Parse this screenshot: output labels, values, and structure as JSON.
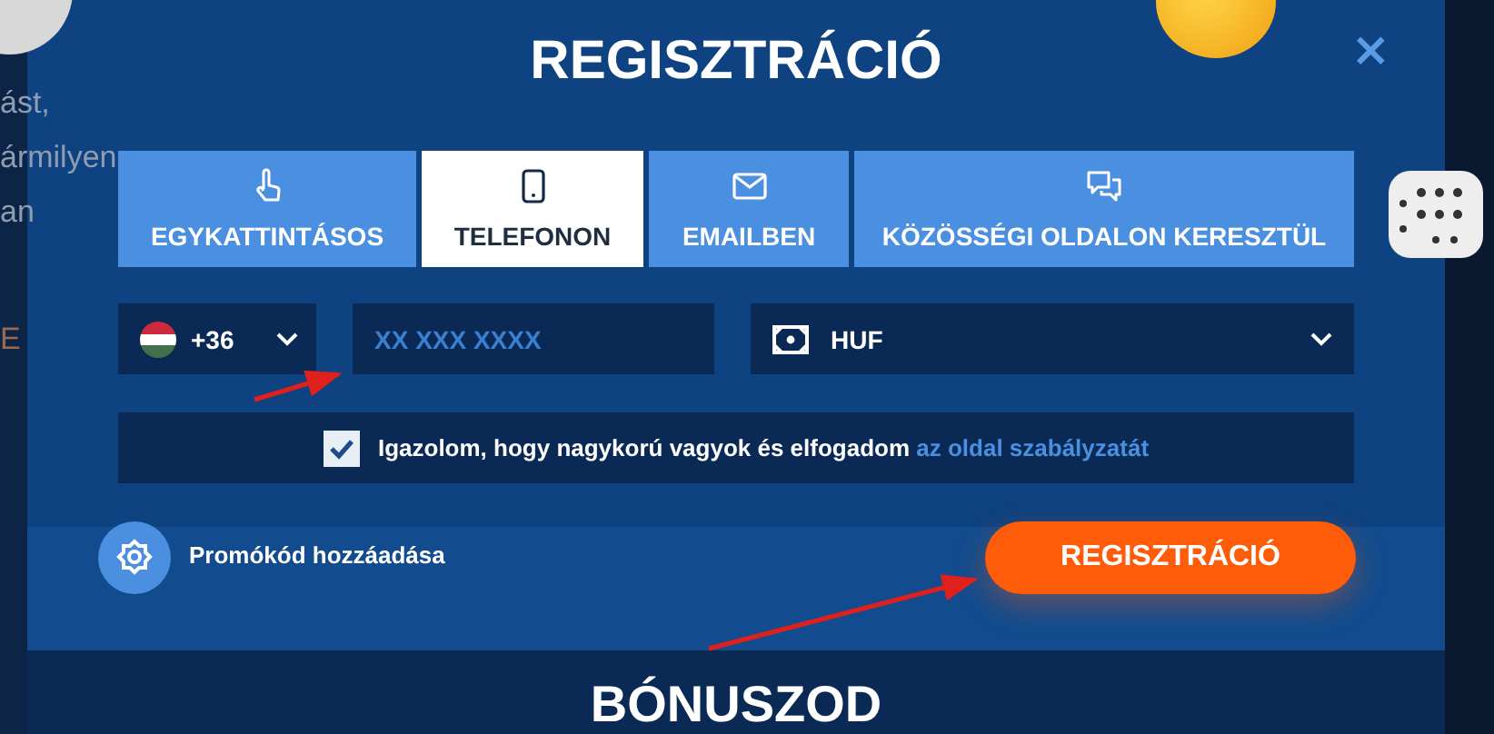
{
  "background_text": [
    "ást,",
    "ármilyen",
    "an",
    "E"
  ],
  "dialog": {
    "title": "REGISZTRÁCIÓ",
    "close": "×"
  },
  "tabs": [
    {
      "label": "EGYKATTINTÁSOS",
      "kind": "oneclick",
      "selected": false
    },
    {
      "label": "TELEFONON",
      "kind": "phone",
      "selected": true
    },
    {
      "label": "EMAILBEN",
      "kind": "email",
      "selected": false
    },
    {
      "label": "KÖZÖSSÉGI OLDALON KERESZTÜL",
      "kind": "social",
      "selected": false
    }
  ],
  "phone": {
    "country_code": "+36",
    "placeholder": "XX XXX XXXX"
  },
  "currency": {
    "value": "HUF"
  },
  "terms": {
    "checked": true,
    "text": "Igazolom, hogy nagykorú vagyok és elfogadom",
    "link": "az oldal szabályzatát"
  },
  "promo": {
    "label": "Promókód hozzáadása"
  },
  "submit": "REGISZTRÁCIÓ",
  "bonus_heading": "BÓNUSZOD"
}
